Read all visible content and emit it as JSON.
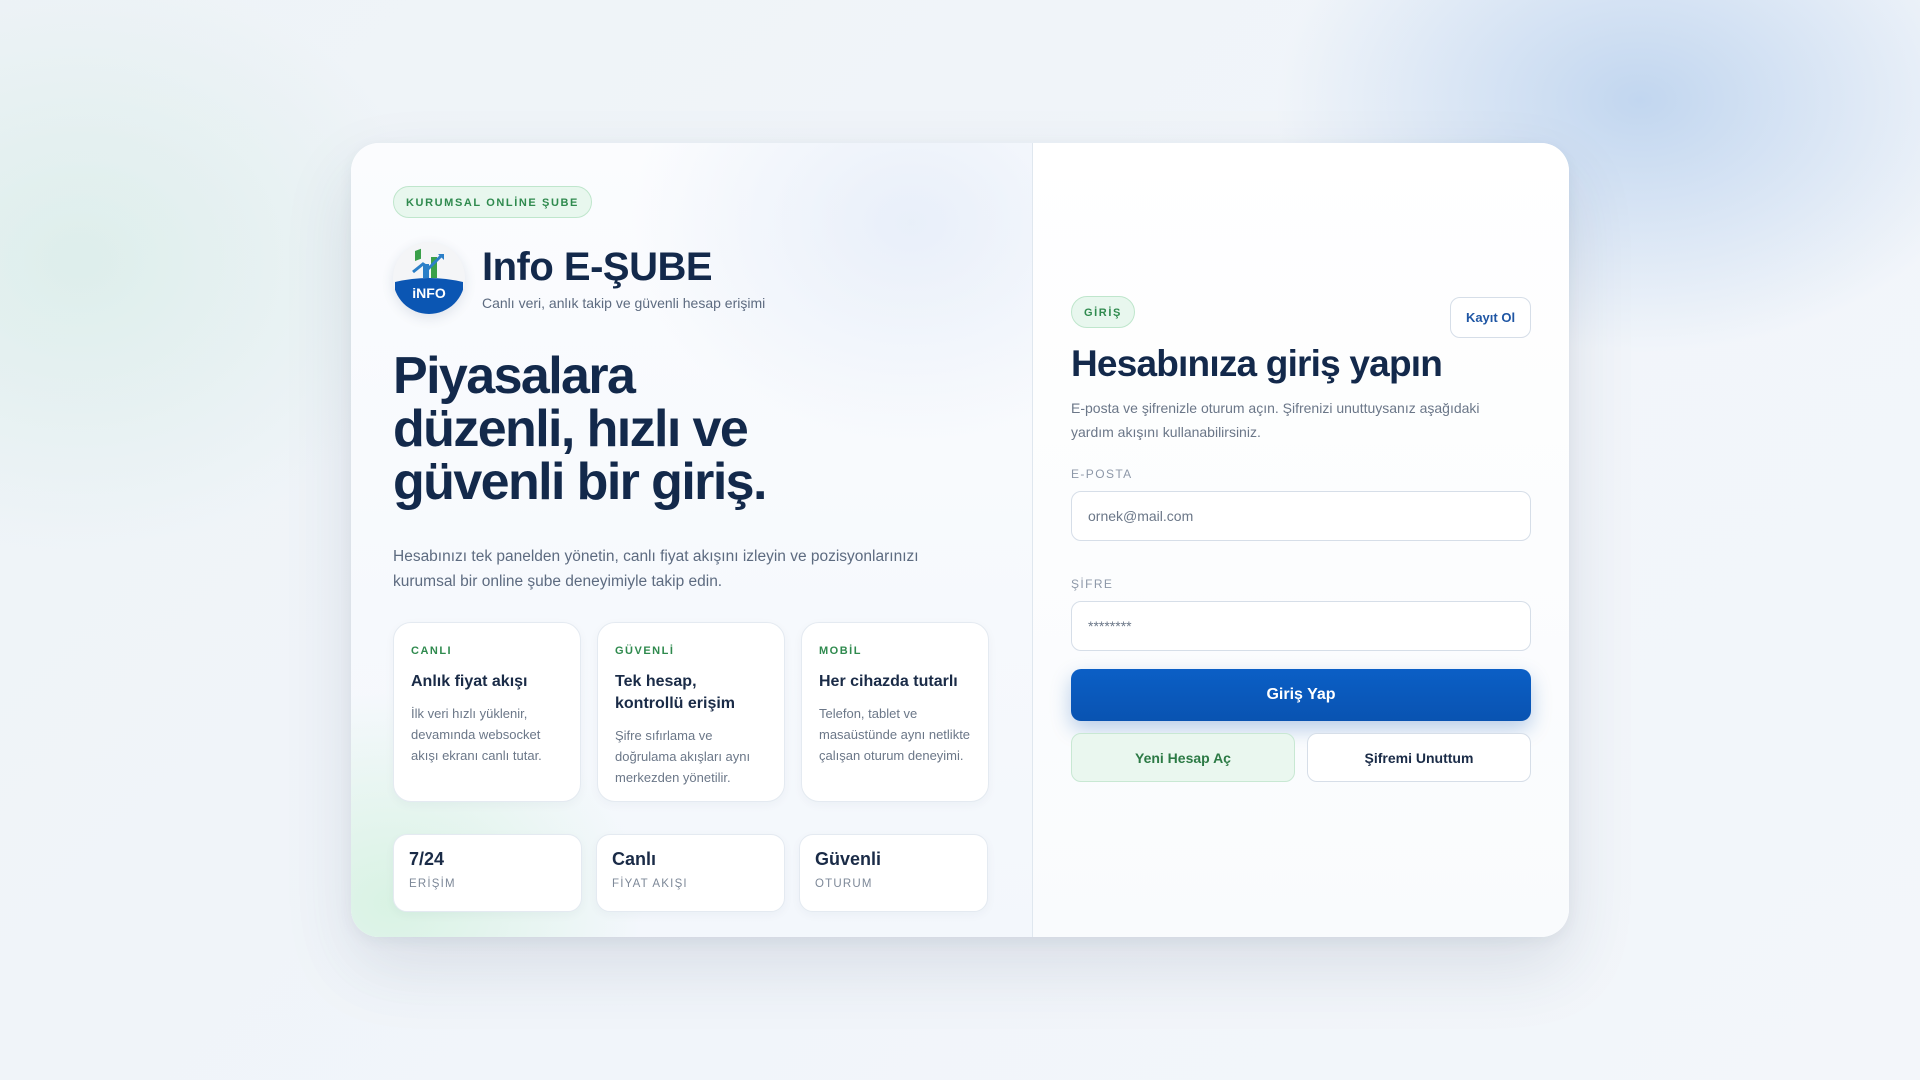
{
  "left": {
    "badge": "KURUMSAL ONLİNE ŞUBE",
    "brand_title": "Info E-ŞUBE",
    "brand_subtitle": "Canlı veri, anlık takip ve güvenli hesap erişimi",
    "logo_text": "iNFO",
    "hero_title": "Piyasalara düzenli, hızlı ve güvenli bir giriş.",
    "lead": "Hesabınızı tek panelden yönetin, canlı fiyat akışını izleyin ve pozisyonlarınızı kurumsal bir online şube deneyimiyle takip edin.",
    "features": [
      {
        "tag": "CANLI",
        "title": "Anlık fiyat akışı",
        "desc": "İlk veri hızlı yüklenir, devamında websocket akışı ekranı canlı tutar."
      },
      {
        "tag": "GÜVENLİ",
        "title": "Tek hesap, kontrollü erişim",
        "desc": "Şifre sıfırlama ve doğrulama akışları aynı merkezden yönetilir."
      },
      {
        "tag": "MOBİL",
        "title": "Her cihazda tutarlı",
        "desc": "Telefon, tablet ve masaüstünde aynı netlikte çalışan oturum deneyimi."
      }
    ],
    "stats": [
      {
        "value": "7/24",
        "label": "ERİŞİM"
      },
      {
        "value": "Canlı",
        "label": "FİYAT AKIŞI"
      },
      {
        "value": "Güvenli",
        "label": "OTURUM"
      }
    ]
  },
  "right": {
    "tab_badge": "GİRİŞ",
    "signup_label": "Kayıt Ol",
    "title": "Hesabınıza giriş yapın",
    "description": "E-posta ve şifrenizle oturum açın. Şifrenizi unuttuysanız aşağıdaki yardım akışını kullanabilirsiniz.",
    "email_label": "E-POSTA",
    "email_placeholder": "ornek@mail.com",
    "password_label": "ŞİFRE",
    "password_placeholder": "********",
    "login_label": "Giriş Yap",
    "new_account_label": "Yeni Hesap Aç",
    "forgot_label": "Şifremi Unuttum"
  },
  "colors": {
    "primary": "#0b5fc6",
    "accent_green": "#2f8a4e",
    "heading": "#13294b"
  }
}
